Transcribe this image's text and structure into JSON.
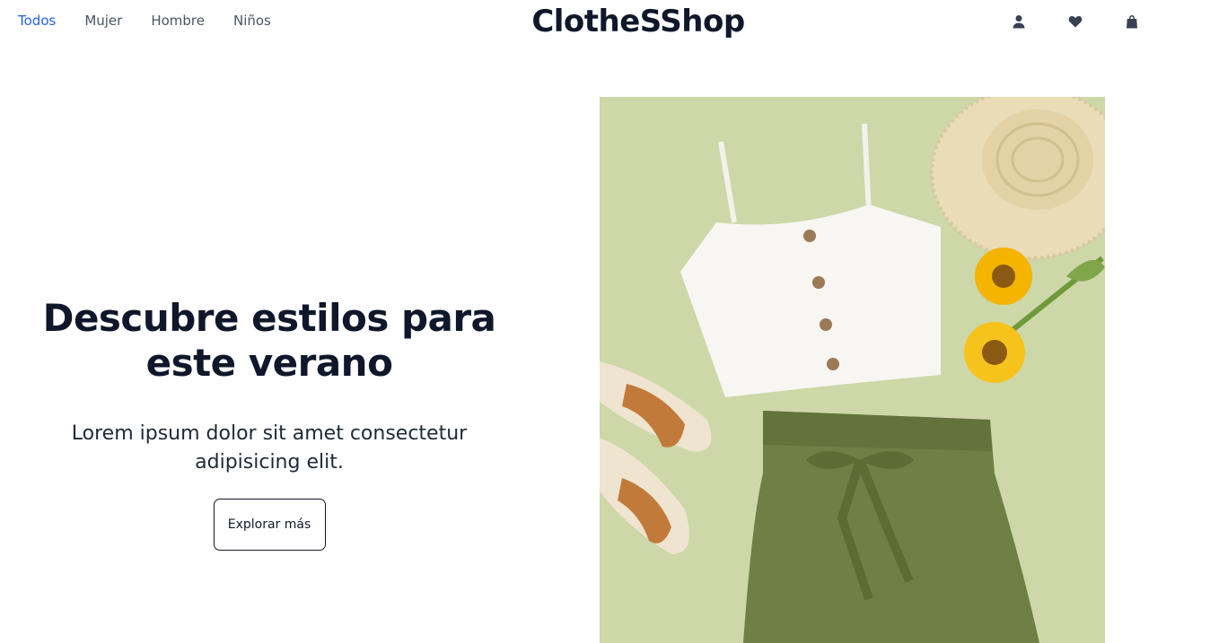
{
  "nav": {
    "links": [
      "Todos",
      "Mujer",
      "Hombre",
      "Niños"
    ],
    "active": "Todos",
    "brand": "ClotheSShop",
    "icons": [
      "user-icon",
      "heart-icon",
      "shopping-bag-icon"
    ]
  },
  "hero": {
    "title": "Descubre estilos para este verano",
    "subtitle": "Lorem ipsum dolor sit amet consectetur adipisicing elit.",
    "button_label": "Explorar más"
  },
  "colors": {
    "active_link": "#2563eb",
    "nav_link": "#4b5563",
    "brand": "#0f172a",
    "image_background": "#cdd7a8",
    "shorts": "#6f7f45",
    "top": "#f7f6f2",
    "sandals": "#c27a3a",
    "sunflower": "#f4b400"
  }
}
